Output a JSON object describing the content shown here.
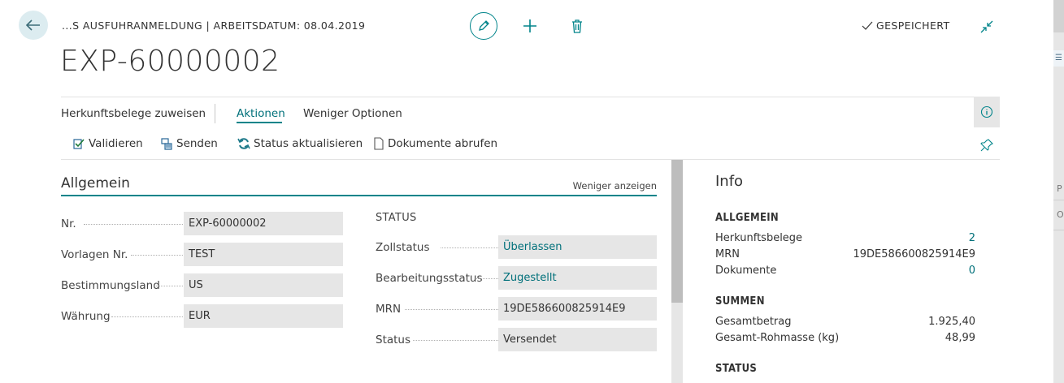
{
  "header": {
    "breadcrumb": "...S AUSFUHRANMELDUNG | ARBEITSDATUM: 08.04.2019",
    "title": "EXP-60000002",
    "saved_label": "GESPEICHERT"
  },
  "actionbar": {
    "items": [
      "Herkunftsbelege zuweisen",
      "Aktionen",
      "Weniger Optionen"
    ]
  },
  "subactions": {
    "validate": "Validieren",
    "send": "Senden",
    "update_status": "Status aktualisieren",
    "fetch_documents": "Dokumente abrufen"
  },
  "general": {
    "title": "Allgemein",
    "show_less": "Weniger anzeigen",
    "fields": [
      {
        "label": "Nr.",
        "value": "EXP-60000002"
      },
      {
        "label": "Vorlagen Nr.",
        "value": "TEST"
      },
      {
        "label": "Bestimmungsland",
        "value": "US"
      },
      {
        "label": "Währung",
        "value": "EUR"
      }
    ],
    "status_heading": "STATUS",
    "status_fields": [
      {
        "label": "Zollstatus",
        "value": "Überlassen"
      },
      {
        "label": "Bearbeitungsstatus",
        "value": "Zugestellt"
      },
      {
        "label": "MRN",
        "value": "19DE586600825914E9"
      },
      {
        "label": "Status",
        "value": "Versendet"
      }
    ]
  },
  "factbox": {
    "title": "Info",
    "allgemein": {
      "heading": "ALLGEMEIN",
      "rows": [
        {
          "label": "Herkunftsbelege",
          "value": "2"
        },
        {
          "label": "MRN",
          "value": "19DE586600825914E9"
        },
        {
          "label": "Dokumente",
          "value": "0"
        }
      ]
    },
    "summen": {
      "heading": "SUMMEN",
      "rows": [
        {
          "label": "Gesamtbetrag",
          "value": "1.925,40"
        },
        {
          "label": "Gesamt-Rohmasse (kg)",
          "value": "48,99"
        }
      ]
    },
    "status_heading": "STATUS"
  },
  "right_edge": {
    "letter_p": "P",
    "text_of": "OF"
  },
  "colors": {
    "accent": "#00848a",
    "link": "#00707a",
    "field_bg": "#e6e6e6"
  }
}
